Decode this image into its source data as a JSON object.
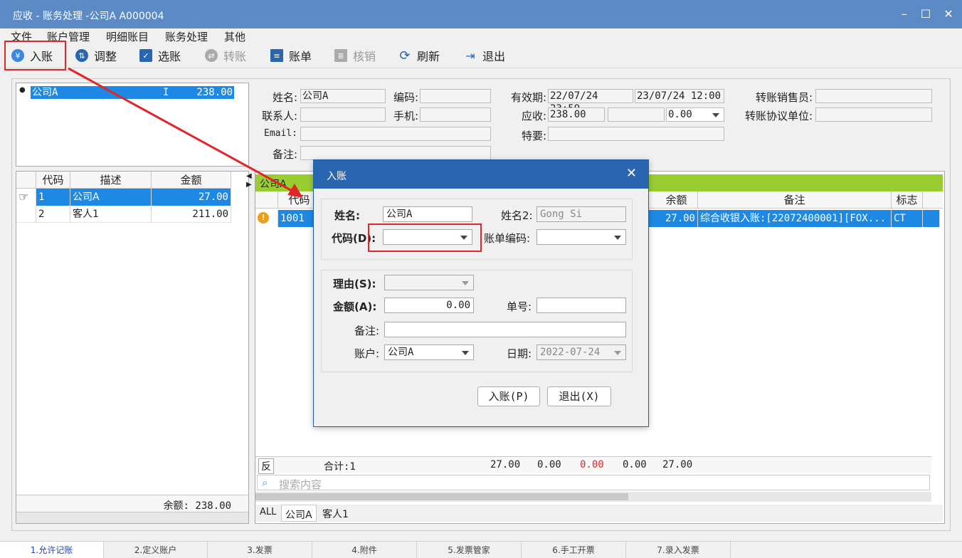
{
  "window": {
    "title": "应收 - 账务处理 -公司A  A000004"
  },
  "menu": [
    "文件",
    "账户管理",
    "明细账目",
    "账务处理",
    "其他"
  ],
  "toolbar": {
    "post": "入账",
    "adjust": "调整",
    "select": "选账",
    "transfer": "转账",
    "bill": "账单",
    "writeoff": "核销",
    "refresh": "刷新",
    "exit": "退出"
  },
  "account_tree": {
    "name": "公司A",
    "flag": "I",
    "amount": "238.00"
  },
  "info": {
    "name_label": "姓名:",
    "name_value": "公司A",
    "code_label": "编码:",
    "contact_label": "联系人:",
    "mobile_label": "手机:",
    "email_label": "Email:",
    "note_label": "备注:",
    "valid_label": "有效期:",
    "valid_from": "22/07/24 23:59",
    "valid_to": "23/07/24 12:00",
    "receivable_label": "应收:",
    "receivable_value": "238.00",
    "receivable_extra": "0.00",
    "special_label": "特要:",
    "salesman_label": "转账销售员:",
    "unit_label": "转账协议单位:"
  },
  "left_grid": {
    "headers": [
      "代码",
      "描述",
      "金额"
    ],
    "rows": [
      {
        "code": "1",
        "desc": "公司A",
        "amount": "27.00"
      },
      {
        "code": "2",
        "desc": "客人1",
        "amount": "211.00"
      }
    ],
    "balance": "余额: 238.00"
  },
  "right_grid": {
    "group": "公司A",
    "headers": {
      "code": "代码",
      "balance": "余额",
      "note": "备注",
      "flag": "标志"
    },
    "row": {
      "code": "1001",
      "balance": "27.00",
      "note": "综合收银入账:[22072400001][FOX...",
      "flag": "CT"
    },
    "footer": {
      "rev": "反",
      "total": "合计:1",
      "v1": "27.00",
      "v2": "0.00",
      "v3": "0.00",
      "v4": "0.00",
      "v5": "27.00"
    },
    "search_placeholder": "搜索内容",
    "tabs": [
      "ALL",
      "公司A",
      "客人1"
    ]
  },
  "dialog": {
    "title": "入账",
    "name_label": "姓名:",
    "name_value": "公司A",
    "name2_label": "姓名2:",
    "name2_value": "Gong Si",
    "code_label": "代码(D):",
    "bill_code_label": "账单编码:",
    "reason_label": "理由(S):",
    "amount_label": "金额(A):",
    "amount_value": "0.00",
    "ticket_label": "单号:",
    "note_label": "备注:",
    "account_label": "账户:",
    "account_value": "公司A",
    "date_label": "日期:",
    "date_value": "2022-07-24",
    "ok_button": "入账(P)",
    "cancel_button": "退出(X)"
  },
  "status_tabs": [
    "1.允许记账",
    "2.定义账户",
    "3.发票",
    "4.附件",
    "5.发票管家",
    "6.手工开票",
    "7.录入发票"
  ],
  "colors": {
    "accent": "#2a66b0",
    "selection": "#1e88e5",
    "group_header": "#9acd32",
    "highlight": "#e0262a"
  }
}
